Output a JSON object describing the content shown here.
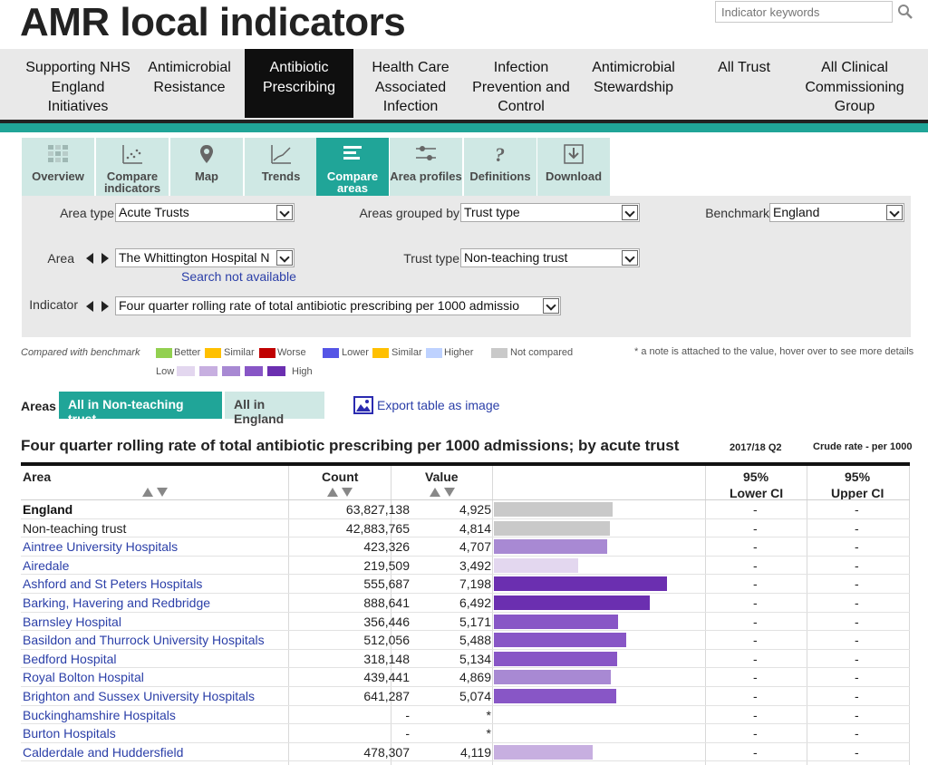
{
  "header": {
    "title": "AMR local indicators",
    "search_placeholder": "Indicator keywords"
  },
  "nav": [
    {
      "label": "Supporting NHS England Initiatives",
      "active": false
    },
    {
      "label": "Antimicrobial Resistance",
      "active": false
    },
    {
      "label": "Antibiotic Prescribing",
      "active": true
    },
    {
      "label": "Health Care Associated Infection",
      "active": false
    },
    {
      "label": "Infection Prevention and Control",
      "active": false
    },
    {
      "label": "Antimicrobial Stewardship",
      "active": false
    },
    {
      "label": "All Trust",
      "active": false
    },
    {
      "label": "All Clinical Commissioning Group",
      "active": false
    }
  ],
  "tabs": [
    {
      "label": "Overview",
      "icon": "overview-grid-icon"
    },
    {
      "label": "Compare indicators",
      "icon": "scatter-icon"
    },
    {
      "label": "Map",
      "icon": "map-pin-icon"
    },
    {
      "label": "Trends",
      "icon": "line-trend-icon"
    },
    {
      "label": "Compare areas",
      "icon": "bars-icon",
      "active": true
    },
    {
      "label": "Area profiles",
      "icon": "sliders-icon"
    },
    {
      "label": "Definitions",
      "icon": "question-icon"
    },
    {
      "label": "Download",
      "icon": "download-icon"
    }
  ],
  "filters": {
    "area_type_label": "Area type",
    "area_type_value": "Acute Trusts",
    "grouped_by_label": "Areas grouped by",
    "grouped_by_value": "Trust type",
    "benchmark_label": "Benchmark",
    "benchmark_value": "England",
    "area_label": "Area",
    "area_value": "The Whittington Hospital N",
    "search_not_available": "Search not available",
    "trust_type_label": "Trust type",
    "trust_type_value": "Non-teaching trust",
    "indicator_label": "Indicator",
    "indicator_value": "Four quarter rolling rate of total antibiotic prescribing per 1000 admissio"
  },
  "legend": {
    "compared_label": "Compared with benchmark",
    "items": [
      {
        "label": "Better",
        "color": "#92d050"
      },
      {
        "label": "Similar",
        "color": "#ffc000"
      },
      {
        "label": "Worse",
        "color": "#c00000"
      },
      {
        "label": "Lower",
        "color": "#5555e6"
      },
      {
        "label": "Similar",
        "color": "#ffc000"
      },
      {
        "label": "Higher",
        "color": "#bed2ff"
      },
      {
        "label": "Not compared",
        "color": "#c9c9c9"
      }
    ],
    "note": "* a note is attached to the value, hover over to see more details",
    "low_label": "Low",
    "high_label": "High",
    "scale_colors": [
      "#e3d7ef",
      "#c7afe0",
      "#a889d3",
      "#8856c6",
      "#6b2fb0"
    ]
  },
  "areas_toggle": {
    "label": "Areas",
    "option_group": "All in Non-teaching trust",
    "option_england": "All in England",
    "export": "Export table as image"
  },
  "table": {
    "title": "Four quarter rolling rate of total antibiotic prescribing per 1000 admissions; by acute trust",
    "period": "2017/18 Q2",
    "unit": "Crude rate - per 1000",
    "headers": {
      "area": "Area",
      "count": "Count",
      "value": "Value",
      "lci_1": "95%",
      "lci_2": "Lower CI",
      "uci_1": "95%",
      "uci_2": "Upper CI"
    },
    "rows": [
      {
        "area": "England",
        "count": "63,827,138",
        "value": "4,925",
        "num": 4925,
        "color": "#c9c9c9",
        "style": "bold",
        "lci": "-",
        "uci": "-"
      },
      {
        "area": "Non-teaching trust",
        "count": "42,883,765",
        "value": "4,814",
        "num": 4814,
        "color": "#c9c9c9",
        "style": "plain",
        "lci": "-",
        "uci": "-"
      },
      {
        "area": "Aintree University Hospitals",
        "count": "423,326",
        "value": "4,707",
        "num": 4707,
        "color": "#a889d3",
        "style": "link",
        "lci": "-",
        "uci": "-"
      },
      {
        "area": "Airedale",
        "count": "219,509",
        "value": "3,492",
        "num": 3492,
        "color": "#e3d7ef",
        "style": "link",
        "lci": "-",
        "uci": "-"
      },
      {
        "area": "Ashford and St Peters Hospitals",
        "count": "555,687",
        "value": "7,198",
        "num": 7198,
        "color": "#6b2fb0",
        "style": "link",
        "lci": "-",
        "uci": "-"
      },
      {
        "area": "Barking, Havering and Redbridge",
        "count": "888,641",
        "value": "6,492",
        "num": 6492,
        "color": "#6b2fb0",
        "style": "link",
        "lci": "-",
        "uci": "-"
      },
      {
        "area": "Barnsley Hospital",
        "count": "356,446",
        "value": "5,171",
        "num": 5171,
        "color": "#8856c6",
        "style": "link",
        "lci": "-",
        "uci": "-"
      },
      {
        "area": "Basildon and Thurrock University Hospitals",
        "count": "512,056",
        "value": "5,488",
        "num": 5488,
        "color": "#8856c6",
        "style": "link",
        "lci": "-",
        "uci": "-"
      },
      {
        "area": "Bedford Hospital",
        "count": "318,148",
        "value": "5,134",
        "num": 5134,
        "color": "#8856c6",
        "style": "link",
        "lci": "-",
        "uci": "-"
      },
      {
        "area": "Royal Bolton Hospital",
        "count": "439,441",
        "value": "4,869",
        "num": 4869,
        "color": "#a889d3",
        "style": "link",
        "lci": "-",
        "uci": "-"
      },
      {
        "area": "Brighton and Sussex University Hospitals",
        "count": "641,287",
        "value": "5,074",
        "num": 5074,
        "color": "#8856c6",
        "style": "link",
        "lci": "-",
        "uci": "-"
      },
      {
        "area": "Buckinghamshire Hospitals",
        "count": "-",
        "value": "*",
        "num": null,
        "color": "",
        "style": "link",
        "lci": "-",
        "uci": "-"
      },
      {
        "area": "Burton Hospitals",
        "count": "-",
        "value": "*",
        "num": null,
        "color": "",
        "style": "link",
        "lci": "-",
        "uci": "-"
      },
      {
        "area": "Calderdale and Huddersfield",
        "count": "478,307",
        "value": "4,119",
        "num": 4119,
        "color": "#c7afe0",
        "style": "link",
        "lci": "-",
        "uci": "-"
      }
    ],
    "bar_max": 7198
  }
}
